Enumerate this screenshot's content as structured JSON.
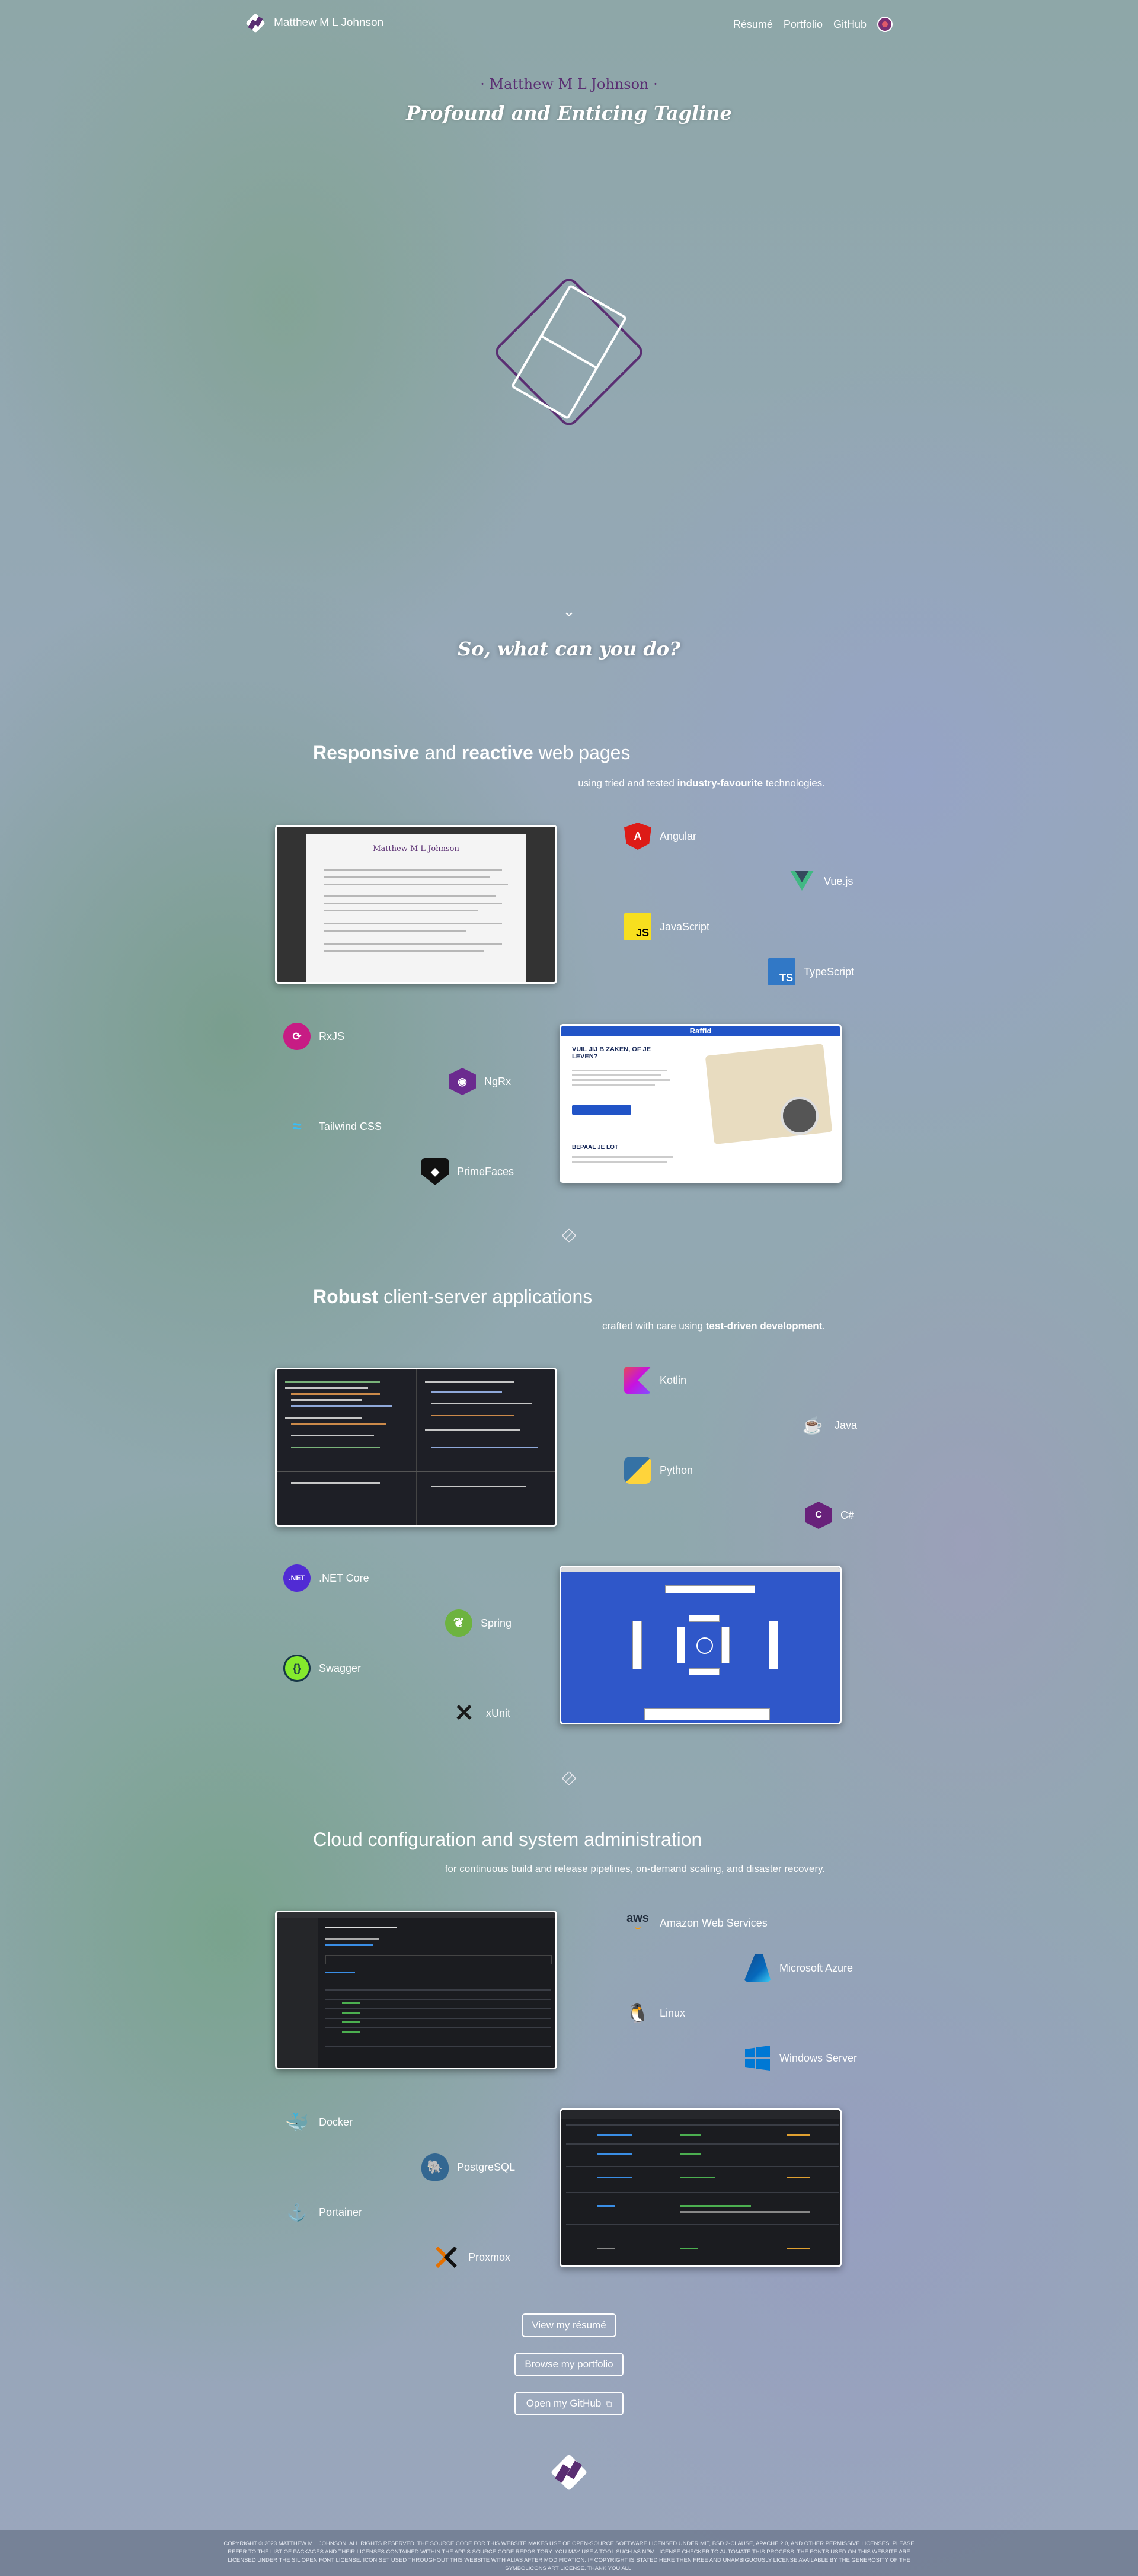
{
  "nav": {
    "brand": "Matthew M L Johnson",
    "links": [
      "Résumé",
      "Portfolio",
      "GitHub"
    ]
  },
  "hero": {
    "name": "· Matthew M L Johnson ·",
    "tagline": "Profound and Enticing Tagline",
    "question": "So, what can you do?"
  },
  "sections": [
    {
      "title_bold1": "Responsive",
      "title_mid": " and ",
      "title_bold2": "reactive",
      "title_end": " web pages",
      "sub_pre": "using tried and tested ",
      "sub_bold": "industry-favourite",
      "sub_post": " technologies.",
      "techs": [
        "Angular",
        "Vue.js",
        "JavaScript",
        "TypeScript",
        "RxJS",
        "NgRx",
        "Tailwind CSS",
        "PrimeFaces"
      ]
    },
    {
      "title_bold1": "Robust",
      "title_end": " client-server applications",
      "sub_pre": "crafted with care using ",
      "sub_bold": "test-driven development",
      "sub_post": ".",
      "techs": [
        "Kotlin",
        "Java",
        "Python",
        "C#",
        ".NET Core",
        "Spring",
        "Swagger",
        "xUnit"
      ]
    },
    {
      "title_end": "Cloud configuration and system administration",
      "sub_pre": "for continuous build and release pipelines, on-demand scaling, and disaster recovery.",
      "techs": [
        "Amazon Web Services",
        "Microsoft Azure",
        "Linux",
        "Windows Server",
        "Docker",
        "PostgreSQL",
        "Portainer",
        "Proxmox"
      ]
    }
  ],
  "screens": {
    "resume_name": "Matthew M L Johnson",
    "raffid_logo": "Raffid",
    "raffid_heading": "VUIL JIJ B ZAKEN, OF JE LEVEN?",
    "raffid_heading2": "BEPAAL JE LOT"
  },
  "buttons": {
    "resume": "View my résumé",
    "portfolio": "Browse my portfolio",
    "github": "Open my GitHub"
  },
  "footer": {
    "text": "COPYRIGHT © 2023 MATTHEW M L JOHNSON. ALL RIGHTS RESERVED. THE SOURCE CODE FOR THIS WEBSITE MAKES USE OF OPEN-SOURCE SOFTWARE LICENSED UNDER MIT, BSD 2-CLAUSE, APACHE 2.0, AND OTHER PERMISSIVE LICENSES. PLEASE REFER TO THE LIST OF PACKAGES AND THEIR LICENSES CONTAINED WITHIN THE APP'S SOURCE CODE REPOSITORY. YOU MAY USE A TOOL SUCH AS NPM LICENSE CHECKER TO AUTOMATE THIS PROCESS. THE FONTS USED ON THIS WEBSITE ARE LICENSED UNDER THE SIL OPEN FONT LICENSE. ICON SET USED THROUGHOUT THIS WEBSITE WITH ALIAS AFTER MODIFICATION. IF COPYRIGHT IS STATED HERE THEN FREE AND UNAMBIGUOUSLY LICENSE AVAILABLE BY THE GENEROSITY OF THE SYMBOLICONS ART LICENSE. THANK YOU ALL."
  },
  "colors": {
    "brand_purple": "#5a2e72",
    "angular": "#dd1b16",
    "vue": "#41b883",
    "js": "#f7df1e",
    "ts": "#3178c6"
  }
}
